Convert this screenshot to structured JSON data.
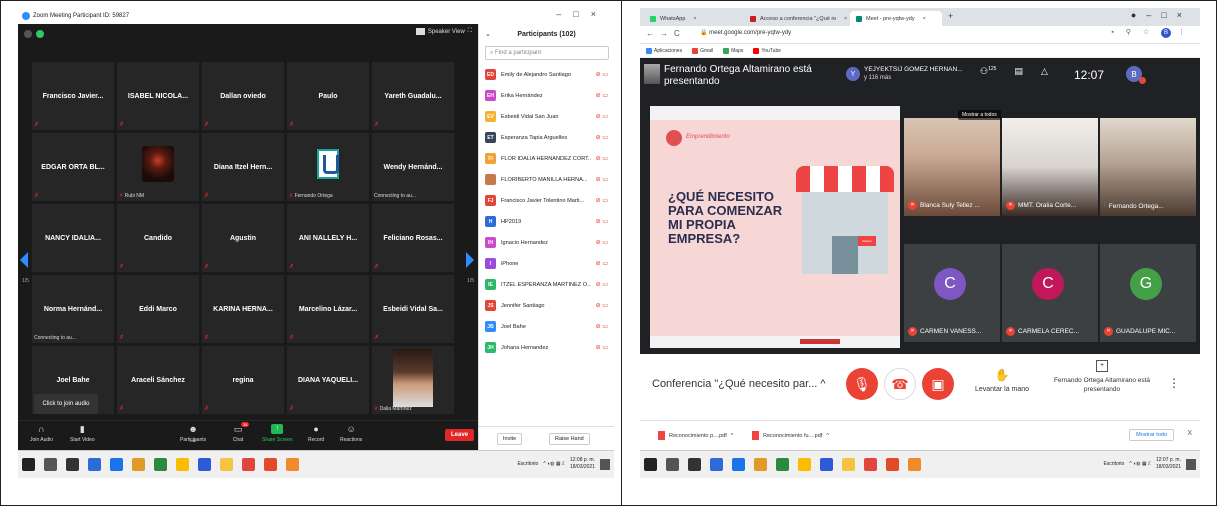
{
  "zoom": {
    "title": "Zoom Meeting Participant ID: 59827",
    "speaker_view": "Speaker View",
    "page_left": "1/5",
    "page_right": "1/5",
    "tooltip": "Click to join audio",
    "tiles": [
      {
        "name": "Francisco Javier...",
        "sub": ""
      },
      {
        "name": "ISABEL NICOLA...",
        "sub": ""
      },
      {
        "name": "Dallan oviedo",
        "sub": ""
      },
      {
        "name": "Paulo",
        "sub": ""
      },
      {
        "name": "Yareth Guadalu...",
        "sub": ""
      },
      {
        "name": "EDGAR ORTA BL...",
        "sub": ""
      },
      {
        "name": "",
        "sub": "Rubi NM"
      },
      {
        "name": "Diana Itzel Hern...",
        "sub": ""
      },
      {
        "name": "",
        "sub": "Fernando Ortega"
      },
      {
        "name": "Wendy Hernánd...",
        "sub": "Connecting to au..."
      },
      {
        "name": "NANCY IDALIA...",
        "sub": ""
      },
      {
        "name": "Candido",
        "sub": ""
      },
      {
        "name": "Agustin",
        "sub": ""
      },
      {
        "name": "ANI NALLELY H...",
        "sub": ""
      },
      {
        "name": "Feliciano Rosas...",
        "sub": ""
      },
      {
        "name": "Norma Hernánd...",
        "sub": "Connecting to au..."
      },
      {
        "name": "Eddi Marco",
        "sub": ""
      },
      {
        "name": "KARINA HERNA...",
        "sub": ""
      },
      {
        "name": "Marcelino Lázar...",
        "sub": ""
      },
      {
        "name": "Esbeidi Vidal Sa...",
        "sub": ""
      },
      {
        "name": "Joel Bahe",
        "sub": ""
      },
      {
        "name": "Araceli Sánchez",
        "sub": ""
      },
      {
        "name": "regina",
        "sub": ""
      },
      {
        "name": "DIANA YAQUELI...",
        "sub": ""
      },
      {
        "name": "",
        "sub": "Dalia Martínez"
      }
    ],
    "toolbar": {
      "join_audio": "Join Audio",
      "start_video": "Start Video",
      "participants": "Participants",
      "participants_count": "102",
      "chat": "Chat",
      "chat_badge": "38",
      "share_screen": "Share Screen",
      "record": "Record",
      "reactions": "Reactions",
      "leave": "Leave"
    },
    "panel": {
      "title": "Participants (102)",
      "search_placeholder": "Find a participant",
      "participants": [
        {
          "initials": "ED",
          "name": "Emily de Alejandro Santiago",
          "color": "#e0463a"
        },
        {
          "initials": "EH",
          "name": "Erika Hernández",
          "color": "#c84bc8"
        },
        {
          "initials": "EV",
          "name": "Esbeidi Vidal San Juan",
          "color": "#f2b233"
        },
        {
          "initials": "ET",
          "name": "Esperanza Tapia Arguelles",
          "color": "#37475a"
        },
        {
          "initials": "FI",
          "name": "FLOR IDALIA HERNÁNDEZ CORT...",
          "color": "#f2a233"
        },
        {
          "initials": "",
          "name": "FLORIBERTO MANILLA HERNÁ...",
          "color": "#c87a4a"
        },
        {
          "initials": "FJ",
          "name": "Francisco Javier Tolentino Marti...",
          "color": "#e0463a"
        },
        {
          "initials": "H",
          "name": "HP2019",
          "color": "#2d6bd8"
        },
        {
          "initials": "IH",
          "name": "Ignacio Hernandez",
          "color": "#c84bc8"
        },
        {
          "initials": "I",
          "name": "iPhone",
          "color": "#9b4bd8"
        },
        {
          "initials": "IE",
          "name": "ITZEL ESPERANZA MARTINEZ O...",
          "color": "#2eb86a"
        },
        {
          "initials": "JS",
          "name": "Jennifer Santiago",
          "color": "#e0463a"
        },
        {
          "initials": "JB",
          "name": "Joel Bahe",
          "color": "#2d8cff"
        },
        {
          "initials": "JH",
          "name": "Johana Hernandez",
          "color": "#2eb86a"
        }
      ],
      "invite": "Invite",
      "raise_hand": "Raise Hand"
    },
    "taskbar": {
      "desktop": "Escritorio",
      "time": "12:08 p. m.",
      "date": "18/03/2021"
    }
  },
  "meet": {
    "tabs": [
      {
        "label": "WhatsApp",
        "color": "#25d366"
      },
      {
        "label": "Acceso a conferencia \"¿Qué nec",
        "color": "#c5221f"
      },
      {
        "label": "Meet - pre-yqtw-ydy",
        "color": "#00897b"
      }
    ],
    "url": "meet.google.com/pre-yqtw-ydy",
    "user_initial": "B",
    "bookmarks": [
      {
        "label": "Aplicaciones",
        "color": "#4285f4"
      },
      {
        "label": "Gmail",
        "color": "#ea4335"
      },
      {
        "label": "Maps",
        "color": "#34a853"
      },
      {
        "label": "YouTube",
        "color": "#ff0000"
      }
    ],
    "presenter_text": "Fernando Ortega Altamirano está presentando",
    "pinned": {
      "initial": "Y",
      "name": "YEJYEKTSIJ GOMEZ HERNAN...",
      "sub": "y 116 más"
    },
    "people_count": "125",
    "time": "12:07",
    "show_all": "Mostrar a todos",
    "slide": {
      "brand": "Emprendimiento",
      "title": "¿QUÉ NECESITO PARA COMENZAR MI PROPIA EMPRESA?",
      "sign": "Abierto"
    },
    "tiles": [
      {
        "name": "Blanca Suly Tellez ...",
        "initial": "",
        "color": "#c9a892"
      },
      {
        "name": "MMT. Oralia Corte...",
        "initial": "",
        "color": "#d8d3ce"
      },
      {
        "name": "Fernando Ortega...",
        "initial": "",
        "color": "#b6a494"
      },
      {
        "name": "CARMEN VANESS...",
        "initial": "C",
        "color": "#7e57c2"
      },
      {
        "name": "CARMELA CEREC...",
        "initial": "C",
        "color": "#c2185b"
      },
      {
        "name": "GUADALUPE MIC...",
        "initial": "G",
        "color": "#43a047"
      }
    ],
    "conference": "Conferencia \"¿Qué necesito par...",
    "raise_hand": "Levantar la mano",
    "presenting": "Fernando Ortega Altamirano está presentando",
    "downloads": [
      "Reconocimiento p....pdf",
      "Reconocimiento fu....pdf"
    ],
    "show_all_downloads": "Mostrar todo",
    "taskbar": {
      "desktop": "Escritorio",
      "time": "12:07 p. m.",
      "date": "18/03/2021"
    }
  }
}
